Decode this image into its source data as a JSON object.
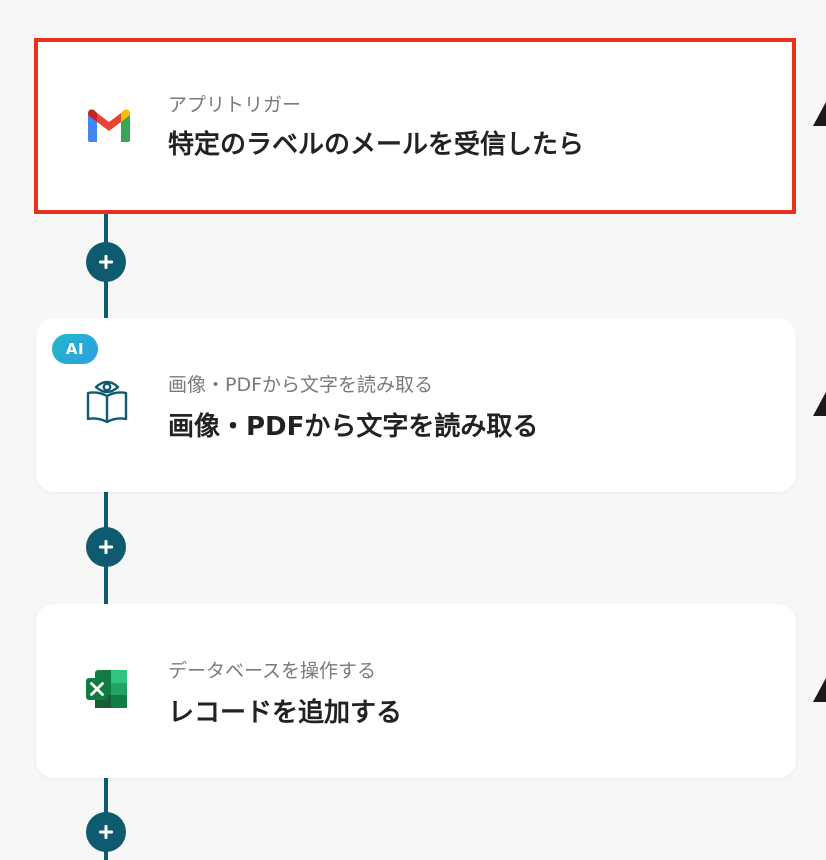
{
  "flow": {
    "steps": [
      {
        "badge": "",
        "icon": "gmail-icon",
        "subtitle": "アプリトリガー",
        "title": "特定のラベルのメールを受信したら",
        "selected": true
      },
      {
        "badge": "AI",
        "icon": "ocr-book-eye-icon",
        "subtitle": "画像・PDFから文字を読み取る",
        "title": "画像・PDFから文字を読み取る",
        "selected": false
      },
      {
        "badge": "",
        "icon": "excel-icon",
        "subtitle": "データベースを操作する",
        "title": "レコードを追加する",
        "selected": false
      }
    ],
    "add_step_icon": "plus-icon",
    "warning_icon": "warning-triangle-icon"
  },
  "colors": {
    "connector": "#0e5a6e",
    "selected_border": "#e8321e",
    "ai_badge": "#23b7c9",
    "background": "#f7f7f7"
  }
}
